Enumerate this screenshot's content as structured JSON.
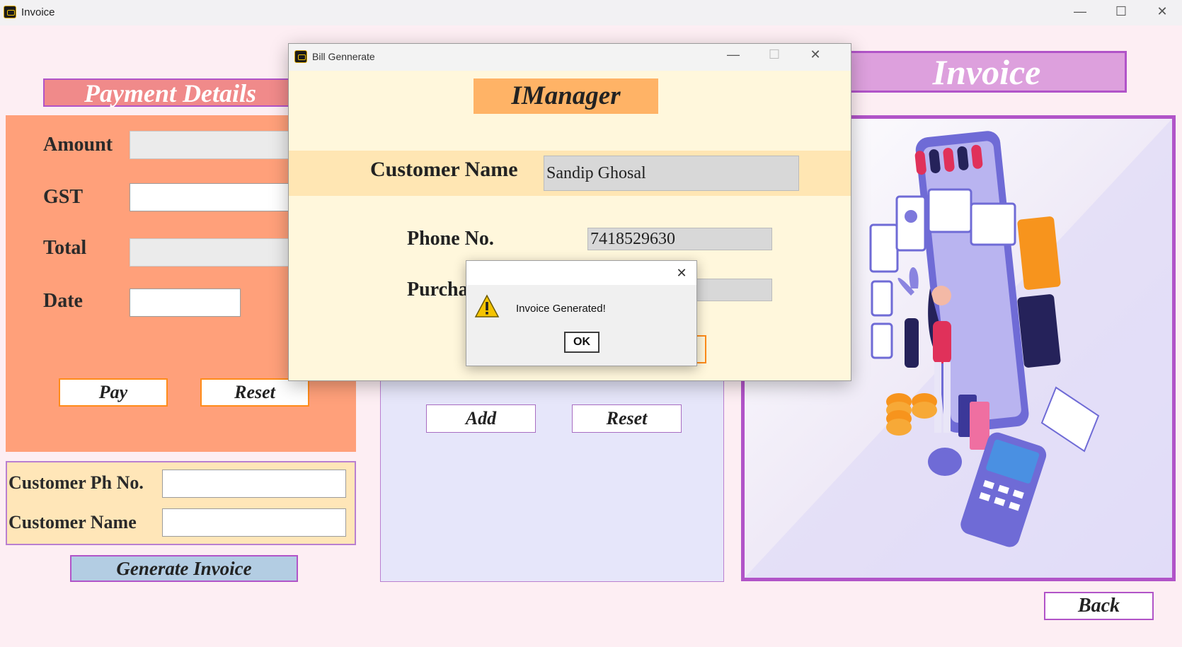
{
  "window": {
    "title": "Invoice",
    "minimize": "—",
    "maximize": "☐",
    "close": "✕"
  },
  "payment": {
    "header": "Payment Details",
    "amount_label": "Amount",
    "gst_label": "GST",
    "total_label": "Total",
    "date_label": "Date",
    "amount_value": "",
    "gst_value": "",
    "total_value": "",
    "date_value": "",
    "pay_button": "Pay",
    "reset_button": "Reset"
  },
  "customer": {
    "phone_label": "Customer Ph No.",
    "name_label": "Customer Name",
    "phone_value": "",
    "name_value": "",
    "generate_button": "Generate Invoice"
  },
  "middle": {
    "add_button": "Add",
    "reset_button": "Reset"
  },
  "invoice_panel": {
    "header": "Invoice",
    "back_button": "Back"
  },
  "bill_dialog": {
    "title": "Bill Gennerate",
    "minimize": "—",
    "maximize": "☐",
    "close": "✕",
    "heading": "IManager",
    "customer_name_label": "Customer Name",
    "customer_name_value": "Sandip Ghosal",
    "phone_label": "Phone No.",
    "phone_value": "7418529630",
    "purchase_label": "Purcha",
    "purchase_value": ""
  },
  "message_box": {
    "close": "✕",
    "message": "Invoice Generated!",
    "ok_button": "OK"
  },
  "colors": {
    "background": "#fdeef3",
    "payment_panel": "#ffa07a",
    "accent_purple": "#b154c8",
    "invoice_header": "#dda0dd",
    "dialog_background": "#fff7dc",
    "imanager_header": "#ffb366"
  }
}
